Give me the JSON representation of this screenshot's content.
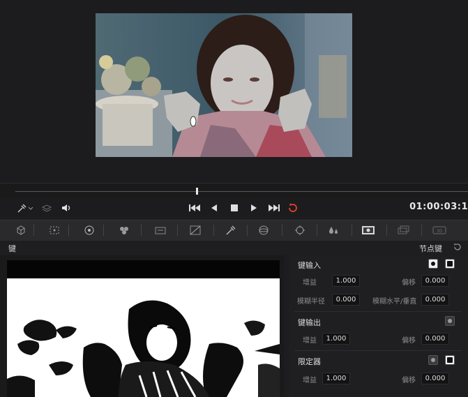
{
  "transport": {
    "timecode": "01:00:03:1",
    "buttons": [
      "jump-to-start",
      "step-back",
      "stop",
      "play",
      "jump-to-end",
      "loop"
    ],
    "loop_color": "#e0402a"
  },
  "toolbar": {
    "tools": [
      "3d-cube-icon",
      "grid-select-icon",
      "circle-target-icon",
      "color-dots-icon",
      "motion-icon",
      "curves-icon",
      "eyedropper-icon",
      "sphere-icon",
      "tracker-icon",
      "blur-drop-icon",
      "key-image-icon",
      "layers-icon",
      "3d-badge-icon"
    ]
  },
  "panel": {
    "title": "键",
    "node_key_label": "节点键"
  },
  "key_input": {
    "title": "键输入",
    "gain_label": "增益",
    "gain_value": "1.000",
    "offset_label": "偏移",
    "offset_value": "0.000",
    "blur_radius_label": "模糊半径",
    "blur_radius_value": "0.000",
    "blur_hv_label": "模糊水平/垂直",
    "blur_hv_value": "0.000"
  },
  "key_output": {
    "title": "键输出",
    "gain_label": "增益",
    "gain_value": "1.000",
    "offset_label": "偏移",
    "offset_value": "0.000"
  },
  "qualifier": {
    "title": "限定器",
    "gain_label": "增益",
    "gain_value": "1.000",
    "offset_label": "偏移",
    "offset_value": "0.000"
  },
  "playhead_progress": 0.4
}
